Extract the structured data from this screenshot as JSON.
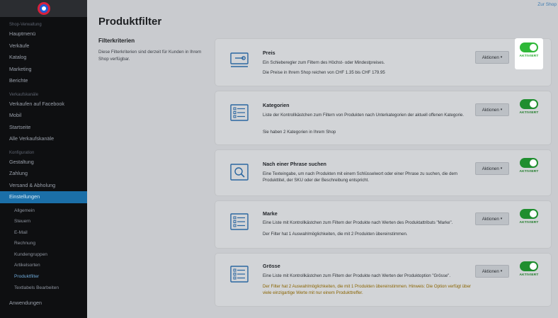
{
  "sidebar": {
    "sections": [
      {
        "title": "Shop-Verwaltung",
        "items": [
          "Hauptmenü",
          "Verkäufe",
          "Katalog",
          "Marketing",
          "Berichte"
        ]
      },
      {
        "title": "Verkaufskanäle",
        "items": [
          "Verkaufen auf Facebook",
          "Mobil",
          "Startseite",
          "Alle Verkaufskanäle"
        ]
      },
      {
        "title": "Konfiguration",
        "items": [
          "Gestaltung",
          "Zahlung",
          "Versand & Abholung",
          "Einstellungen"
        ]
      }
    ],
    "subitems": [
      "Allgemein",
      "Steuern",
      "E-Mail",
      "Rechnung",
      "Kundengruppen",
      "Artikelsorten",
      "Produktfilter",
      "Textlabels Bearbeiten"
    ],
    "bottom_item": "Anwendungen"
  },
  "top_link": "Zur Shop",
  "page_title": "Produktfilter",
  "left": {
    "title": "Filterkriterien",
    "description": "Diese Filterkriterien sind derzeit für Kunden in Ihrem Shop verfügbar."
  },
  "actions_label": "Aktionen",
  "toggle_label": "AKTIVIERT",
  "cards": [
    {
      "title": "Preis",
      "line1": "Ein Schieberegler zum Filtern des Höchst- oder Mindestpreises.",
      "line2": "Die Preise in Ihrem Shop reichen von CHF 1.35 bis CHF 179.95",
      "icon": "price-slider-icon"
    },
    {
      "title": "Kategorien",
      "line1": "Liste der Kontrollkästchen zum Filtern von Produkten nach Unterkategorien der aktuell offenen Kategorie.",
      "line2": "Sie haben 2 Kategorien in Ihrem Shop",
      "icon": "checklist-icon"
    },
    {
      "title": "Nach einer Phrase suchen",
      "line1": "Eine Texteingabe, um nach Produkten mit einem Schlüsselwort oder einer Phrase zu suchen, die dem Produkttitel, der SKU oder der Beschreibung entspricht.",
      "line2": "",
      "icon": "search-icon"
    },
    {
      "title": "Marke",
      "line1": "Eine Liste mit Kontrollkästchen zum Filtern der Produkte nach Werten des Produktattributs \"Marke\".",
      "line2": "Der Filter hat 1 Auswahlmöglichkeiten, die mit 2 Produkten übereinstimmen.",
      "icon": "checklist-icon"
    },
    {
      "title": "Grösse",
      "line1": "Eine Liste mit Kontrollkästchen zum Filtern der Produkte nach Werten der Produktoption \"Grösse\".",
      "line2": "Der Filter hat 2 Auswahlmöglichkeiten, die mit 1 Produkten übereinstimmen. Hinweis: Die Option verfügt über viele einzigartige Werte mit nur einem Produkttreffer.",
      "icon": "checklist-icon"
    }
  ]
}
